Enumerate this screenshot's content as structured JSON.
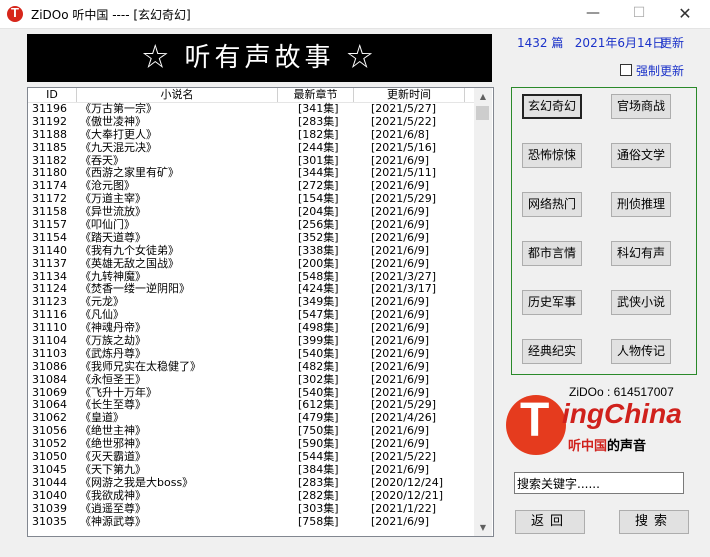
{
  "window": {
    "title": "ZiDOo 听中国 ---- [玄幻奇幻]",
    "min": "—",
    "max": "☐",
    "close": "✕"
  },
  "banner": "☆ 听有声故事 ☆",
  "top_right": {
    "count": "1432 篇   2021年6月14日",
    "update": "更新",
    "force_update": "强制更新"
  },
  "list": {
    "headers": [
      "ID",
      "小说名",
      "最新章节",
      "更新时间"
    ],
    "rows": [
      {
        "id": "31196",
        "name": "《万古第一宗》",
        "chapter": "[341集]",
        "date": "[2021/5/27]"
      },
      {
        "id": "31192",
        "name": "《傲世凌神》",
        "chapter": "[283集]",
        "date": "[2021/5/22]"
      },
      {
        "id": "31188",
        "name": "《大奉打更人》",
        "chapter": "[182集]",
        "date": "[2021/6/8]"
      },
      {
        "id": "31185",
        "name": "《九天混元决》",
        "chapter": "[244集]",
        "date": "[2021/5/16]"
      },
      {
        "id": "31182",
        "name": "《吞天》",
        "chapter": "[301集]",
        "date": "[2021/6/9]"
      },
      {
        "id": "31180",
        "name": "《西游之家里有矿》",
        "chapter": "[344集]",
        "date": "[2021/5/11]"
      },
      {
        "id": "31174",
        "name": "《沧元图》",
        "chapter": "[272集]",
        "date": "[2021/6/9]"
      },
      {
        "id": "31172",
        "name": "《万道主宰》",
        "chapter": "[154集]",
        "date": "[2021/5/29]"
      },
      {
        "id": "31158",
        "name": "《异世流放》",
        "chapter": "[204集]",
        "date": "[2021/6/9]"
      },
      {
        "id": "31157",
        "name": "《叩仙门》",
        "chapter": "[256集]",
        "date": "[2021/6/9]"
      },
      {
        "id": "31154",
        "name": "《踏天道尊》",
        "chapter": "[352集]",
        "date": "[2021/6/9]"
      },
      {
        "id": "31140",
        "name": "《我有九个女徒弟》",
        "chapter": "[338集]",
        "date": "[2021/6/9]"
      },
      {
        "id": "31137",
        "name": "《英雄无敌之国战》",
        "chapter": "[200集]",
        "date": "[2021/6/9]"
      },
      {
        "id": "31134",
        "name": "《九转神魔》",
        "chapter": "[548集]",
        "date": "[2021/3/27]"
      },
      {
        "id": "31124",
        "name": "《焚香一缕一逆阴阳》",
        "chapter": "[424集]",
        "date": "[2021/3/17]"
      },
      {
        "id": "31123",
        "name": "《元龙》",
        "chapter": "[349集]",
        "date": "[2021/6/9]"
      },
      {
        "id": "31116",
        "name": "《凡仙》",
        "chapter": "[547集]",
        "date": "[2021/6/9]"
      },
      {
        "id": "31110",
        "name": "《神魂丹帝》",
        "chapter": "[498集]",
        "date": "[2021/6/9]"
      },
      {
        "id": "31104",
        "name": "《万族之劫》",
        "chapter": "[399集]",
        "date": "[2021/6/9]"
      },
      {
        "id": "31103",
        "name": "《武炼丹尊》",
        "chapter": "[540集]",
        "date": "[2021/6/9]"
      },
      {
        "id": "31086",
        "name": "《我师兄实在太稳健了》",
        "chapter": "[482集]",
        "date": "[2021/6/9]"
      },
      {
        "id": "31084",
        "name": "《永恒圣王》",
        "chapter": "[302集]",
        "date": "[2021/6/9]"
      },
      {
        "id": "31069",
        "name": "《飞升十万年》",
        "chapter": "[540集]",
        "date": "[2021/6/9]"
      },
      {
        "id": "31064",
        "name": "《长生至尊》",
        "chapter": "[612集]",
        "date": "[2021/5/29]"
      },
      {
        "id": "31062",
        "name": "《皇道》",
        "chapter": "[479集]",
        "date": "[2021/4/26]"
      },
      {
        "id": "31056",
        "name": "《绝世主神》",
        "chapter": "[750集]",
        "date": "[2021/6/9]"
      },
      {
        "id": "31052",
        "name": "《绝世邪神》",
        "chapter": "[590集]",
        "date": "[2021/6/9]"
      },
      {
        "id": "31050",
        "name": "《灭天霸道》",
        "chapter": "[544集]",
        "date": "[2021/5/22]"
      },
      {
        "id": "31045",
        "name": "《天下第九》",
        "chapter": "[384集]",
        "date": "[2021/6/9]"
      },
      {
        "id": "31044",
        "name": "《网游之我是大boss》",
        "chapter": "[283集]",
        "date": "[2020/12/24]"
      },
      {
        "id": "31040",
        "name": "《我欲成神》",
        "chapter": "[282集]",
        "date": "[2020/12/21]"
      },
      {
        "id": "31039",
        "name": "《逍遥至尊》",
        "chapter": "[303集]",
        "date": "[2021/1/22]"
      },
      {
        "id": "31035",
        "name": "《神源武尊》",
        "chapter": "[758集]",
        "date": "[2021/6/9]"
      }
    ]
  },
  "categories": [
    {
      "label": "玄幻奇幻",
      "active": true
    },
    {
      "label": "官场商战",
      "active": false
    },
    {
      "label": "恐怖惊悚",
      "active": false
    },
    {
      "label": "通俗文学",
      "active": false
    },
    {
      "label": "网络热门",
      "active": false
    },
    {
      "label": "刑侦推理",
      "active": false
    },
    {
      "label": "都市言情",
      "active": false
    },
    {
      "label": "科幻有声",
      "active": false
    },
    {
      "label": "历史军事",
      "active": false
    },
    {
      "label": "武侠小说",
      "active": false
    },
    {
      "label": "经典纪实",
      "active": false
    },
    {
      "label": "人物传记",
      "active": false
    }
  ],
  "logo": {
    "id_text": "ZiDOo : 614517007",
    "letter": "T",
    "brand": "ingChina",
    "sub_red": "听中国",
    "sub_black": "的声音",
    "color": "#d0211c"
  },
  "search": {
    "value": "搜索关键字......",
    "back_label": "返回",
    "search_label": "搜索"
  }
}
